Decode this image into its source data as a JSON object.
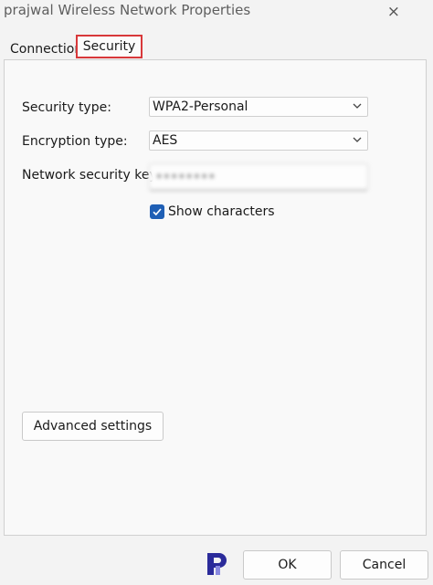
{
  "window": {
    "title": "prajwal Wireless Network Properties",
    "close_icon": "×"
  },
  "tabs": [
    {
      "label": "Connection",
      "selected": false
    },
    {
      "label": "Security",
      "selected": true
    }
  ],
  "security": {
    "security_type_label": "Security type:",
    "security_type_value": "WPA2-Personal",
    "encryption_type_label": "Encryption type:",
    "encryption_type_value": "AES",
    "network_key_label": "Network security key",
    "network_key_value": "••••••••",
    "show_characters_label": "Show characters",
    "show_characters_checked": true,
    "advanced_button": "Advanced settings"
  },
  "footer": {
    "ok_button": "OK",
    "cancel_button": "Cancel"
  },
  "colors": {
    "tab_highlight": "#d8383a",
    "checkbox_accent": "#1f5fb5",
    "logo_dark": "#2b2b9a",
    "logo_light": "#8a8ae0"
  }
}
